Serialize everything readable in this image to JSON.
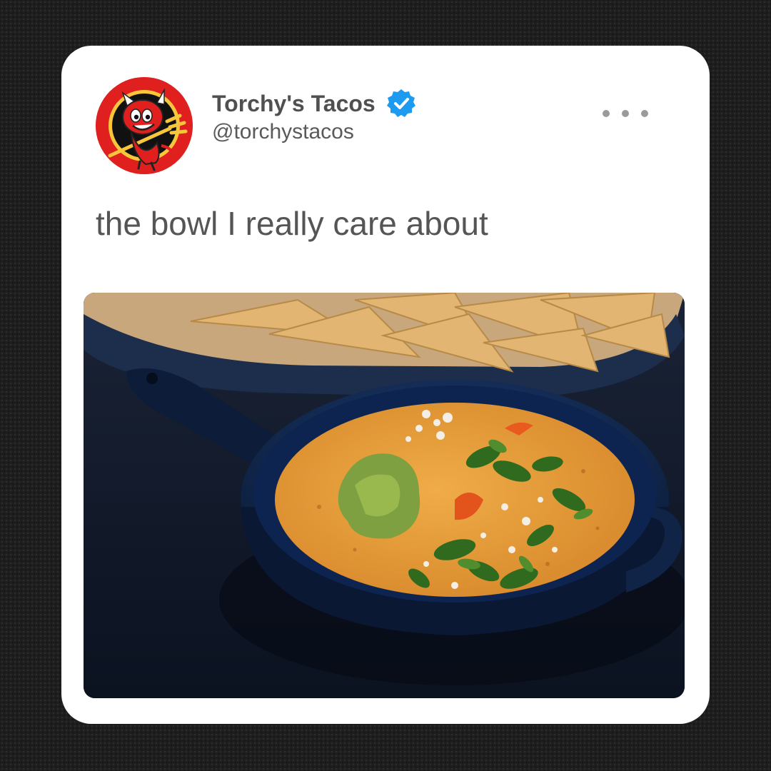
{
  "tweet": {
    "display_name": "Torchy's Tacos",
    "handle": "@torchystacos",
    "verified": true,
    "text": "the bowl I really care about",
    "more_icon": "more-horizontal-icon",
    "avatar_icon": "devil-mascot-logo",
    "media_subject": "queso-bowl-photo"
  },
  "colors": {
    "background": "#1e1e1e",
    "card": "#ffffff",
    "name": "#505050",
    "handle": "#5a5a5a",
    "verified_badge": "#1d9bf0",
    "avatar_red": "#e0201f",
    "queso": "#e59a3a",
    "bowl": "#0f2447"
  }
}
